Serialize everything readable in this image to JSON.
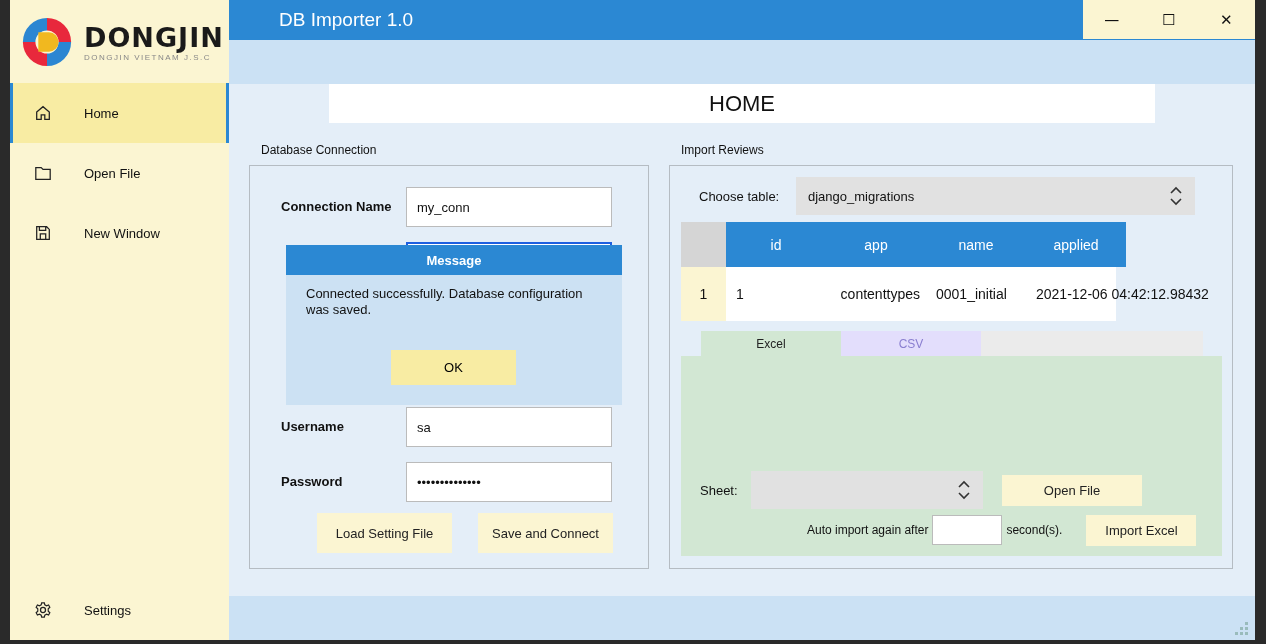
{
  "window": {
    "title": "DB Importer 1.0",
    "controls": [
      "—",
      "☐",
      "✕"
    ]
  },
  "brand": {
    "name": "DONGJIN",
    "tagline": "DONGJIN VIETNAM J.S.C"
  },
  "sidebar": {
    "items": [
      {
        "label": "Home",
        "selected": true
      },
      {
        "label": "Open File",
        "selected": false
      },
      {
        "label": "New Window",
        "selected": false
      }
    ],
    "footer_item": {
      "label": "Settings",
      "selected": false
    }
  },
  "page_heading": "HOME",
  "database_connection": {
    "title": "Database Connection",
    "rows": [
      {
        "label": "Connection Name",
        "field": {
          "value": "my_conn",
          "focused": false
        }
      },
      {
        "field": {
          "focused": true
        }
      },
      {
        "label": "Username",
        "field": {
          "value": "sa",
          "focused": false
        }
      },
      {
        "label": "Password",
        "field": {
          "value": "••••••••••••••",
          "focused": false
        }
      }
    ],
    "buttons": [
      "Load Setting File",
      "Save and Connect"
    ]
  },
  "import_reviews": {
    "title": "Import Reviews",
    "choose_table_label": "Choose table:",
    "table_value": "django_migrations",
    "table": {
      "columns": [
        "id",
        "app",
        "name",
        "applied"
      ],
      "rows": [
        {
          "header": "1",
          "cells": [
            "1",
            "contenttypes",
            "0001_initial",
            "2021-12-06 04:42:12.98432"
          ]
        }
      ]
    },
    "tabs": [
      {
        "label": "Excel",
        "selected": true
      },
      {
        "label": "CSV",
        "selected": false
      }
    ],
    "sheet_label": "Sheet:",
    "open_file_button": "Open File",
    "auto_import_label": "Auto import again after",
    "seconds_label": "second(s).",
    "import_button": "Import Excel"
  },
  "dialog": {
    "title": "Message",
    "text": "Connected successfully. Database configuration was saved.",
    "button": "OK"
  }
}
